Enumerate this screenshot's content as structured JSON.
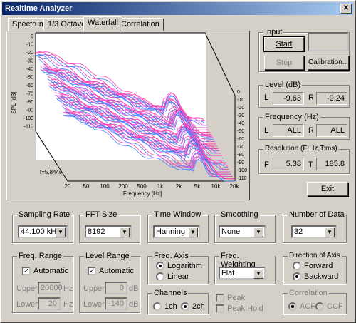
{
  "window": {
    "title": "Realtime Analyzer"
  },
  "tabs": [
    "Spectrum",
    "1/3 Octave",
    "Waterfall",
    "Correlation"
  ],
  "plot": {
    "ylabel": "SPL [dB]",
    "xlabel": "Frequency [Hz]",
    "time_label": "t=5.844s",
    "left_ticks": [
      "0",
      "-10",
      "-20",
      "-30",
      "-40",
      "-50",
      "-60",
      "-70",
      "-80",
      "-90",
      "-100",
      "-110"
    ],
    "right_ticks": [
      "0",
      "-10",
      "-20",
      "-30",
      "-40",
      "-50",
      "-60",
      "-70",
      "-80",
      "-90",
      "-100",
      "-110"
    ],
    "x_ticks": [
      "20",
      "50",
      "100",
      "200",
      "500",
      "1k",
      "2k",
      "5k",
      "10k",
      "20k"
    ],
    "trace_colors": [
      "#ff3fb0",
      "#4d7dff"
    ],
    "frame_color": "#000000"
  },
  "input": {
    "title": "Input",
    "start": "Start",
    "stop": "Stop",
    "calibration": "Calibration..."
  },
  "level": {
    "title": "Level (dB)",
    "l_label": "L",
    "l_value": "-9.63",
    "r_label": "R",
    "r_value": "-9.24"
  },
  "frequency": {
    "title": "Frequency (Hz)",
    "l_label": "L",
    "l_value": "ALL",
    "r_label": "R",
    "r_value": "ALL"
  },
  "resolution": {
    "title": "Resolution (F:Hz,T:ms)",
    "f_label": "F",
    "f_value": "5.38",
    "t_label": "T",
    "t_value": "185.8"
  },
  "exit": "Exit",
  "sampling_rate": {
    "title": "Sampling Rate",
    "value": "44.100 kHz"
  },
  "fft_size": {
    "title": "FFT Size",
    "value": "8192"
  },
  "time_window": {
    "title": "Time Window",
    "value": "Hanning"
  },
  "smoothing": {
    "title": "Smoothing",
    "value": "None"
  },
  "number_of_data": {
    "title": "Number of Data",
    "value": "32"
  },
  "freq_range": {
    "title": "Freq. Range",
    "automatic": "Automatic",
    "upper_label": "Upper",
    "upper_value": "20000",
    "upper_unit": "Hz",
    "lower_label": "Lower",
    "lower_value": "20",
    "lower_unit": "Hz"
  },
  "level_range": {
    "title": "Level Range",
    "automatic": "Automatic",
    "upper_label": "Upper",
    "upper_value": "0",
    "upper_unit": "dB",
    "lower_label": "Lower",
    "lower_value": "-140",
    "lower_unit": "dB"
  },
  "freq_axis": {
    "title": "Freq. Axis",
    "logarithm": "Logarithm",
    "linear": "Linear"
  },
  "channels": {
    "title": "Channels",
    "ch1": "1ch",
    "ch2": "2ch"
  },
  "freq_weighting": {
    "title": "Freq. Weighting",
    "value": "Flat"
  },
  "peak": {
    "peak": "Peak",
    "peak_hold": "Peak Hold"
  },
  "direction": {
    "title": "Direction of Axis",
    "forward": "Forward",
    "backward": "Backward"
  },
  "correlation": {
    "title": "Correlation",
    "acf": "ACF",
    "ccf": "CCF"
  }
}
